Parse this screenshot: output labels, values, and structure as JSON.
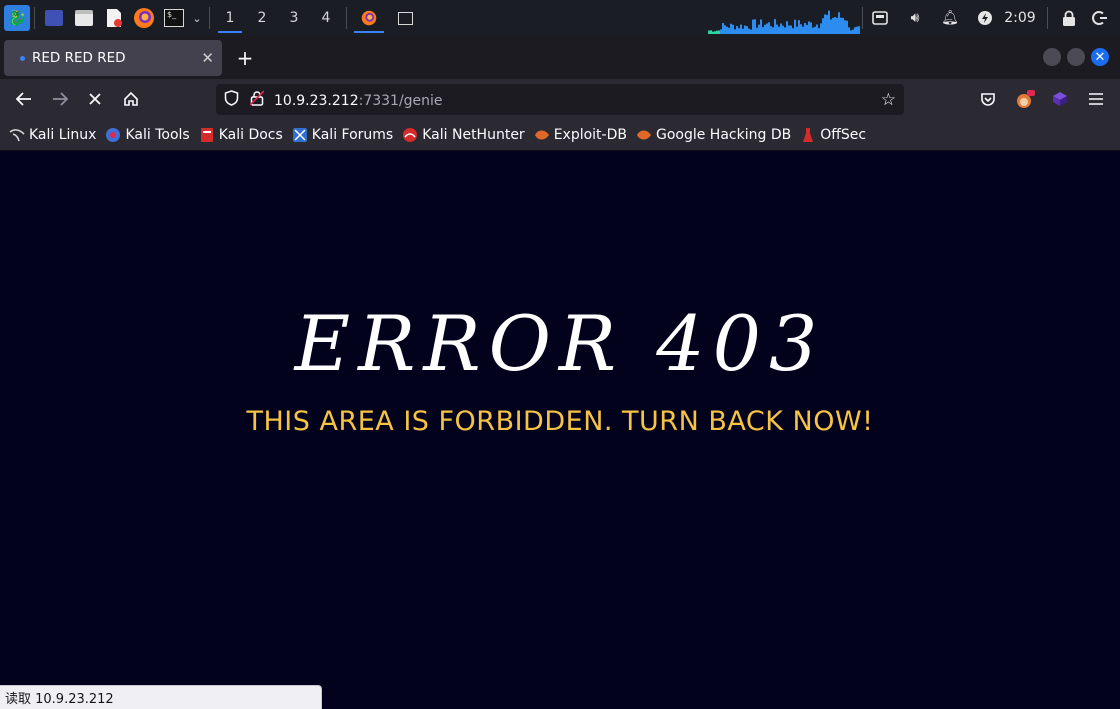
{
  "panel": {
    "workspaces": [
      "1",
      "2",
      "3",
      "4"
    ],
    "clock": "2:09",
    "colors": {
      "accent": "#3b82f6",
      "cpu_graph": "#2d8cf0"
    }
  },
  "browser": {
    "tab_title": "RED RED RED",
    "url_host": "10.9.23.212",
    "url_path": ":7331/genie",
    "bookmarks": [
      "Kali Linux",
      "Kali Tools",
      "Kali Docs",
      "Kali Forums",
      "Kali NetHunter",
      "Exploit-DB",
      "Google Hacking DB",
      "OffSec"
    ],
    "status_text": "读取 10.9.23.212"
  },
  "page": {
    "error_title": "ERROR 403",
    "error_subtitle": "THIS AREA IS FORBIDDEN. TURN BACK NOW!",
    "colors": {
      "background": "#02021d",
      "title": "#ffffff",
      "subtitle": "#f6c343"
    }
  }
}
